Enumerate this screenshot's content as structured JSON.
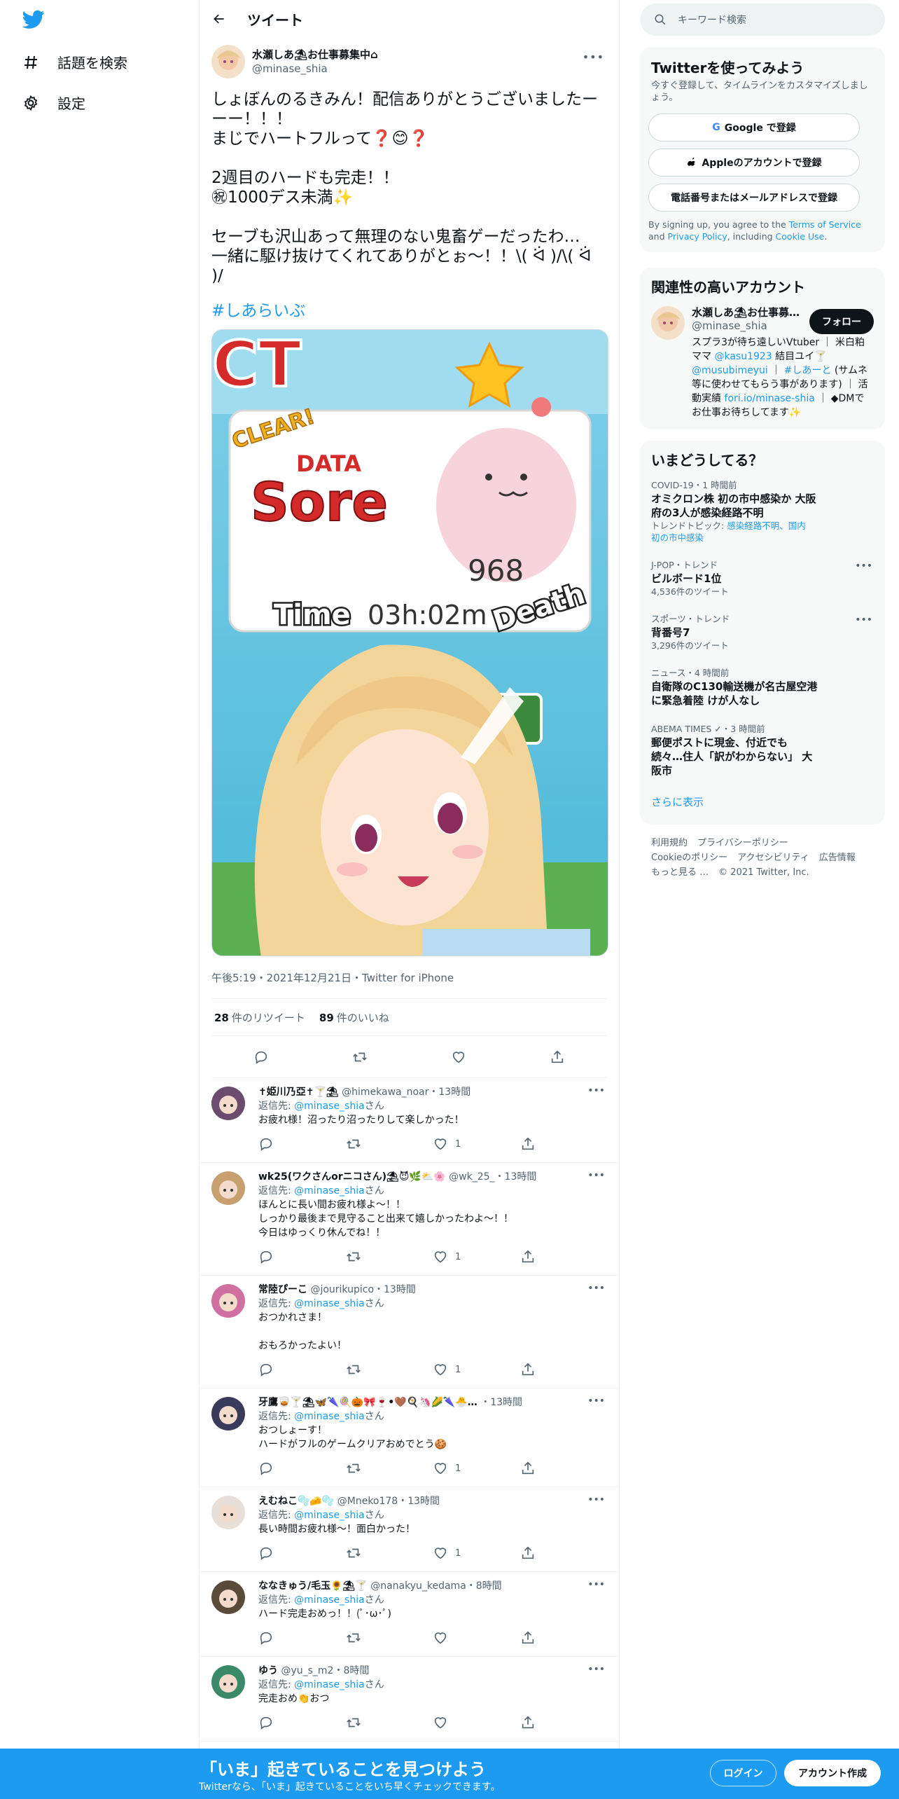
{
  "nav": {
    "explore": "話題を検索",
    "settings": "設定"
  },
  "header": {
    "title": "ツイート"
  },
  "tweet": {
    "name": "水瀬しあ⛱お仕事募集中⌂",
    "handle": "@minase_shia",
    "text": "しょぼんのるきみん！配信ありがとうございましたーーー！！！\nまじでハートフルって❓😊❓\n\n2週目のハードも完走！！\n㊗1000デス未満✨\n\nセーブも沢山あって無理のない鬼畜ゲーだったわ…\n一緒に駆け抜けてくれてありがとぉ〜！！\\( ᐛ )/\\( ᐛ )/",
    "hashtag": "#しあらいぶ",
    "image": {
      "clear": "CLEAR!",
      "data": "DATA",
      "score": "Sore",
      "deaths": "968",
      "death_label": "Death",
      "time_label": "Time",
      "time_value": "03h:02m"
    },
    "meta": "午後5:19・2021年12月21日・Twitter for iPhone",
    "retweets": "28",
    "retweets_label": "件のリツイート",
    "likes": "89",
    "likes_label": "件のいいね"
  },
  "replies": [
    {
      "name": "✝姫川乃亞✝🍸⛱",
      "handle": "@himekawa_noar・13時間",
      "to": "@minase_shia",
      "text": "お疲れ様！沼ったり沼ったりして楽しかった！",
      "likes": "1",
      "avatar_color": "#6b4b6e"
    },
    {
      "name": "wk25(ワクさんorニコさん)⛱😈🌿⛅🌸",
      "handle": "@wk_25_・13時間",
      "to": "@minase_shia",
      "text": "ほんとに長い間お疲れ様よ〜！！\nしっかり最後まで見守ること出来て嬉しかったわよ〜！！\n今日はゆっくり休んでね！！",
      "likes": "1",
      "avatar_color": "#c8a070"
    },
    {
      "name": "常陸ぴーこ",
      "handle": "@jourikupico・13時間",
      "to": "@minase_shia",
      "text": "おつかれさま！\n\nおもろかったよい！",
      "likes": "1",
      "avatar_color": "#d070a0"
    },
    {
      "name": "牙鷹🥃🍸⛱🦋🌂🍭🎃🎀🍷•🤎🍳🦄🌽🌂🐣…",
      "handle": "・13時間",
      "to": "@minase_shia",
      "text": "おつしょーす！\nハードがフルのゲームクリアおめでとう🍪",
      "likes": "1",
      "avatar_color": "#3a3a5a"
    },
    {
      "name": "えむねこ🫧🧀🫧",
      "handle": "@Mneko178・13時間",
      "to": "@minase_shia",
      "text": "長い時間お疲れ様〜！面白かった！",
      "likes": "1",
      "avatar_color": "#e8e0d8"
    },
    {
      "name": "ななきゅう/毛玉🌻⛱🍸",
      "handle": "@nanakyu_kedama・8時間",
      "to": "@minase_shia",
      "text": "ハード完走おめっ！！(ﾟ･ω･ﾟ)",
      "likes": "",
      "avatar_color": "#5a4a3a"
    },
    {
      "name": "ゆう",
      "handle": "@yu_s_m2・8時間",
      "to": "@minase_shia",
      "text": "完走おめ👏おつ",
      "likes": "",
      "avatar_color": "#3a8a6a"
    }
  ],
  "reply_to_label": "返信先: ",
  "reply_to_suffix": "さん",
  "right": {
    "search_placeholder": "キーワード検索",
    "signup": {
      "title": "Twitterを使ってみよう",
      "sub": "今すぐ登録して、タイムラインをカスタマイズしましょう。",
      "google": "Google で登録",
      "apple": "Appleのアカウントで登録",
      "phone": "電話番号またはメールアドレスで登録",
      "terms_1": "By signing up, you agree to the ",
      "terms_tos": "Terms of Service",
      "terms_2": " and ",
      "terms_pp": "Privacy Policy",
      "terms_3": ", including ",
      "terms_cookie": "Cookie Use",
      "terms_4": "."
    },
    "related": {
      "title": "関連性の高いアカウント",
      "name": "水瀬しあ⛱お仕事募…",
      "handle": "@minase_shia",
      "follow": "フォロー",
      "bio_1": "スプラ3が待ち遠しいVtuber ｜ 米白粕ママ ",
      "bio_link1": "@kasu1923",
      "bio_2": " 結目ユイ🍸 ",
      "bio_link2": "@musubimeyui",
      "bio_3": " ｜ ",
      "bio_link3": "#しあーと",
      "bio_4": " (サムネ等に使わせてもらう事があります) ｜ 活動実績 ",
      "bio_link4": "fori.io/minase-shia",
      "bio_5": " ｜ ◆DMでお仕事お待ちしてます✨"
    },
    "trends_title": "いまどうしてる？",
    "trends": [
      {
        "ctx": "COVID-19・1 時間前",
        "title": "オミクロン株 初の市中感染か 大阪\n府の3人が感染経路不明",
        "sub": "トレンドトピック: ",
        "sub_link": "感染経路不明、国内\n初の市中感染",
        "more": false
      },
      {
        "ctx": "J-POP・トレンド",
        "title": "ビルボード1位",
        "sub": "4,536件のツイート",
        "sub_link": "",
        "more": true
      },
      {
        "ctx": "スポーツ・トレンド",
        "title": "背番号7",
        "sub": "3,296件のツイート",
        "sub_link": "",
        "more": true
      },
      {
        "ctx": "ニュース・4 時間前",
        "title": "自衛隊のC130輸送機が名古屋空港\nに緊急着陸 けが人なし",
        "sub": "",
        "sub_link": "",
        "more": false
      },
      {
        "ctx": "ABEMA TIMES ✓・3 時間前",
        "title": "郵便ポストに現金、付近でも\n続々…住人「訳がわからない」 大\n阪市",
        "sub": "",
        "sub_link": "",
        "more": false
      }
    ],
    "show_more": "さらに表示",
    "footer": [
      "利用規約",
      "プライバシーポリシー",
      "Cookieのポリシー",
      "アクセシビリティ",
      "広告情報",
      "もっと見る …",
      "© 2021 Twitter, Inc."
    ]
  },
  "bottom": {
    "title": "「いま」起きていることを見つけよう",
    "sub": "Twitterなら、「いま」起きていることをいち早くチェックできます。",
    "login": "ログイン",
    "signup": "アカウント作成"
  },
  "colors": {
    "accent": "#1d9bf0",
    "text": "#0f1419",
    "muted": "#536471"
  }
}
